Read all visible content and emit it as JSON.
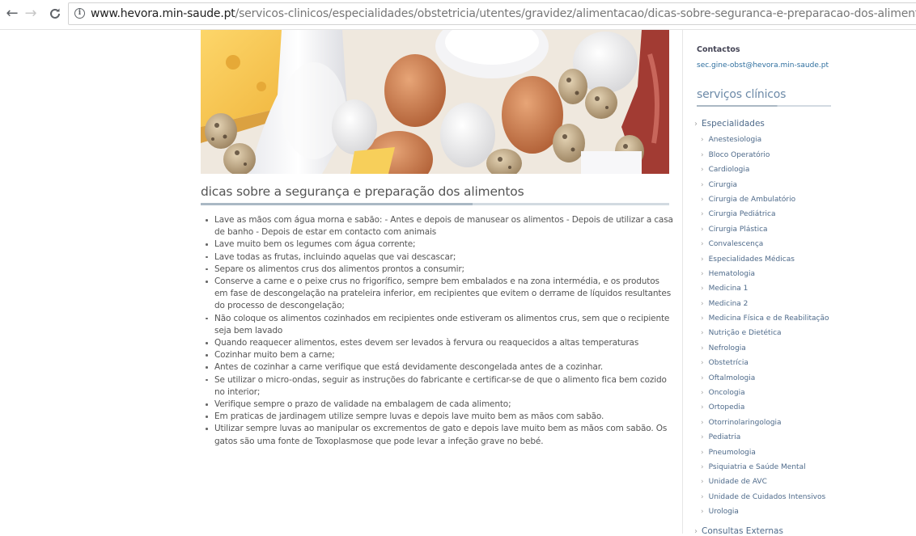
{
  "browser": {
    "url_host": "www.hevora.min-saude.pt",
    "url_path": "/servicos-clinicos/especialidades/obstetricia/utentes/gravidez/alimentacao/dicas-sobre-seguranca-e-preparacao-dos-alimentos/",
    "back_icon": "←",
    "forward_icon": "→",
    "reload_icon": "C",
    "info_icon": "i"
  },
  "article": {
    "title": "dicas sobre a segurança e preparação dos alimentos",
    "tips": [
      "Lave as mãos com água morna e sabão: - Antes e depois de manusear os alimentos - Depois de utilizar a casa de banho - Depois de estar em contacto com animais",
      "Lave muito bem os legumes com água corrente;",
      "Lave todas as frutas, incluindo aquelas que vai descascar;",
      "Separe os alimentos crus dos alimentos prontos a consumir;",
      "Conserve a carne e o peixe crus no frigorífico, sempre bem embalados e na zona intermédia, e os produtos em fase de descongelação na prateleira inferior, em recipientes que evitem o derrame de líquidos resultantes do processo de descongelação;",
      "Não coloque os alimentos cozinhados em recipientes onde estiveram os alimentos crus, sem que o recipiente seja bem lavado",
      "Quando reaquecer alimentos, estes devem ser levados à fervura ou reaquecidos a altas temperaturas",
      "Cozinhar muito bem a carne;",
      "Antes de cozinhar a carne verifique que está devidamente descongelada antes de a cozinhar.",
      "Se utilizar o micro-ondas, seguir as instruções do fabricante e certificar-se de que o alimento fica bem cozido no interior;",
      "Verifique sempre o prazo de validade na embalagem de cada alimento;",
      "Em praticas de jardinagem utilize sempre luvas e depois lave muito bem as mãos com sabão.",
      "Utilizar sempre luvas ao manipular os excrementos de gato e depois lave muito bem as mãos com sabão. Os gatos são uma fonte de Toxoplasmose que pode levar a infeção grave no bebé."
    ]
  },
  "sidebar": {
    "contacts_heading": "Contactos",
    "contacts_email": "sec.gine-obst@hevora.min-saude.pt",
    "services_heading": "serviços clínicos",
    "parent_label": "Especialidades",
    "chevron": "›",
    "items": [
      "Anestesiologia",
      "Bloco Operatório",
      "Cardiologia",
      "Cirurgia",
      "Cirurgia de Ambulatório",
      "Cirurgia Pediátrica",
      "Cirurgia Plástica",
      "Convalescença",
      "Especialidades Médicas",
      "Hematologia",
      "Medicina 1",
      "Medicina 2",
      "Medicina Física e de Reabilitação",
      "Nutrição e Dietética",
      "Nefrologia",
      "Obstetrícia",
      "Oftalmologia",
      "Oncologia",
      "Ortopedia",
      "Otorrinolaringologia",
      "Pediatria",
      "Pneumologia",
      "Psiquiatria e Saúde Mental",
      "Unidade de AVC",
      "Unidade de Cuidados Intensivos",
      "Urologia"
    ],
    "next_parent_label": "Consultas Externas"
  }
}
